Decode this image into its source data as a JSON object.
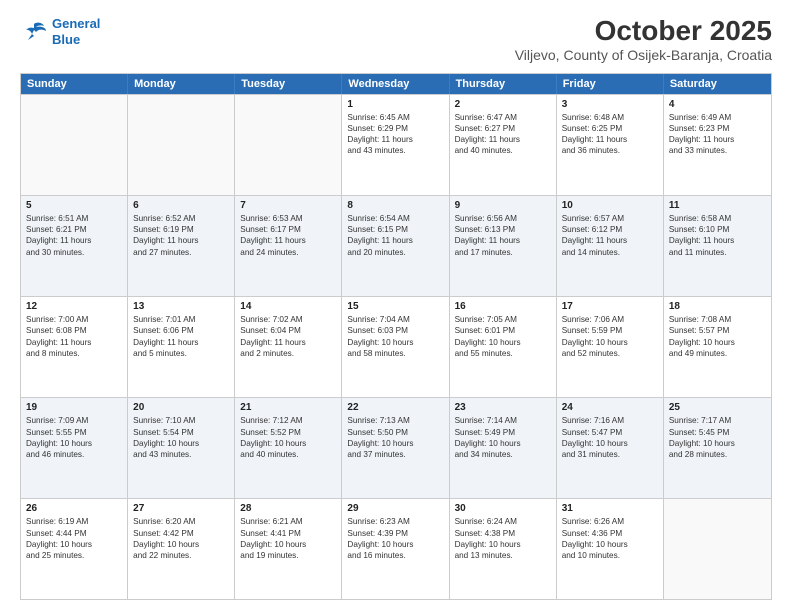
{
  "logo": {
    "line1": "General",
    "line2": "Blue"
  },
  "title": "October 2025",
  "location": "Viljevo, County of Osijek-Baranja, Croatia",
  "days_of_week": [
    "Sunday",
    "Monday",
    "Tuesday",
    "Wednesday",
    "Thursday",
    "Friday",
    "Saturday"
  ],
  "weeks": [
    [
      {
        "day": "",
        "content": ""
      },
      {
        "day": "",
        "content": ""
      },
      {
        "day": "",
        "content": ""
      },
      {
        "day": "1",
        "content": "Sunrise: 6:45 AM\nSunset: 6:29 PM\nDaylight: 11 hours\nand 43 minutes."
      },
      {
        "day": "2",
        "content": "Sunrise: 6:47 AM\nSunset: 6:27 PM\nDaylight: 11 hours\nand 40 minutes."
      },
      {
        "day": "3",
        "content": "Sunrise: 6:48 AM\nSunset: 6:25 PM\nDaylight: 11 hours\nand 36 minutes."
      },
      {
        "day": "4",
        "content": "Sunrise: 6:49 AM\nSunset: 6:23 PM\nDaylight: 11 hours\nand 33 minutes."
      }
    ],
    [
      {
        "day": "5",
        "content": "Sunrise: 6:51 AM\nSunset: 6:21 PM\nDaylight: 11 hours\nand 30 minutes."
      },
      {
        "day": "6",
        "content": "Sunrise: 6:52 AM\nSunset: 6:19 PM\nDaylight: 11 hours\nand 27 minutes."
      },
      {
        "day": "7",
        "content": "Sunrise: 6:53 AM\nSunset: 6:17 PM\nDaylight: 11 hours\nand 24 minutes."
      },
      {
        "day": "8",
        "content": "Sunrise: 6:54 AM\nSunset: 6:15 PM\nDaylight: 11 hours\nand 20 minutes."
      },
      {
        "day": "9",
        "content": "Sunrise: 6:56 AM\nSunset: 6:13 PM\nDaylight: 11 hours\nand 17 minutes."
      },
      {
        "day": "10",
        "content": "Sunrise: 6:57 AM\nSunset: 6:12 PM\nDaylight: 11 hours\nand 14 minutes."
      },
      {
        "day": "11",
        "content": "Sunrise: 6:58 AM\nSunset: 6:10 PM\nDaylight: 11 hours\nand 11 minutes."
      }
    ],
    [
      {
        "day": "12",
        "content": "Sunrise: 7:00 AM\nSunset: 6:08 PM\nDaylight: 11 hours\nand 8 minutes."
      },
      {
        "day": "13",
        "content": "Sunrise: 7:01 AM\nSunset: 6:06 PM\nDaylight: 11 hours\nand 5 minutes."
      },
      {
        "day": "14",
        "content": "Sunrise: 7:02 AM\nSunset: 6:04 PM\nDaylight: 11 hours\nand 2 minutes."
      },
      {
        "day": "15",
        "content": "Sunrise: 7:04 AM\nSunset: 6:03 PM\nDaylight: 10 hours\nand 58 minutes."
      },
      {
        "day": "16",
        "content": "Sunrise: 7:05 AM\nSunset: 6:01 PM\nDaylight: 10 hours\nand 55 minutes."
      },
      {
        "day": "17",
        "content": "Sunrise: 7:06 AM\nSunset: 5:59 PM\nDaylight: 10 hours\nand 52 minutes."
      },
      {
        "day": "18",
        "content": "Sunrise: 7:08 AM\nSunset: 5:57 PM\nDaylight: 10 hours\nand 49 minutes."
      }
    ],
    [
      {
        "day": "19",
        "content": "Sunrise: 7:09 AM\nSunset: 5:55 PM\nDaylight: 10 hours\nand 46 minutes."
      },
      {
        "day": "20",
        "content": "Sunrise: 7:10 AM\nSunset: 5:54 PM\nDaylight: 10 hours\nand 43 minutes."
      },
      {
        "day": "21",
        "content": "Sunrise: 7:12 AM\nSunset: 5:52 PM\nDaylight: 10 hours\nand 40 minutes."
      },
      {
        "day": "22",
        "content": "Sunrise: 7:13 AM\nSunset: 5:50 PM\nDaylight: 10 hours\nand 37 minutes."
      },
      {
        "day": "23",
        "content": "Sunrise: 7:14 AM\nSunset: 5:49 PM\nDaylight: 10 hours\nand 34 minutes."
      },
      {
        "day": "24",
        "content": "Sunrise: 7:16 AM\nSunset: 5:47 PM\nDaylight: 10 hours\nand 31 minutes."
      },
      {
        "day": "25",
        "content": "Sunrise: 7:17 AM\nSunset: 5:45 PM\nDaylight: 10 hours\nand 28 minutes."
      }
    ],
    [
      {
        "day": "26",
        "content": "Sunrise: 6:19 AM\nSunset: 4:44 PM\nDaylight: 10 hours\nand 25 minutes."
      },
      {
        "day": "27",
        "content": "Sunrise: 6:20 AM\nSunset: 4:42 PM\nDaylight: 10 hours\nand 22 minutes."
      },
      {
        "day": "28",
        "content": "Sunrise: 6:21 AM\nSunset: 4:41 PM\nDaylight: 10 hours\nand 19 minutes."
      },
      {
        "day": "29",
        "content": "Sunrise: 6:23 AM\nSunset: 4:39 PM\nDaylight: 10 hours\nand 16 minutes."
      },
      {
        "day": "30",
        "content": "Sunrise: 6:24 AM\nSunset: 4:38 PM\nDaylight: 10 hours\nand 13 minutes."
      },
      {
        "day": "31",
        "content": "Sunrise: 6:26 AM\nSunset: 4:36 PM\nDaylight: 10 hours\nand 10 minutes."
      },
      {
        "day": "",
        "content": ""
      }
    ]
  ]
}
